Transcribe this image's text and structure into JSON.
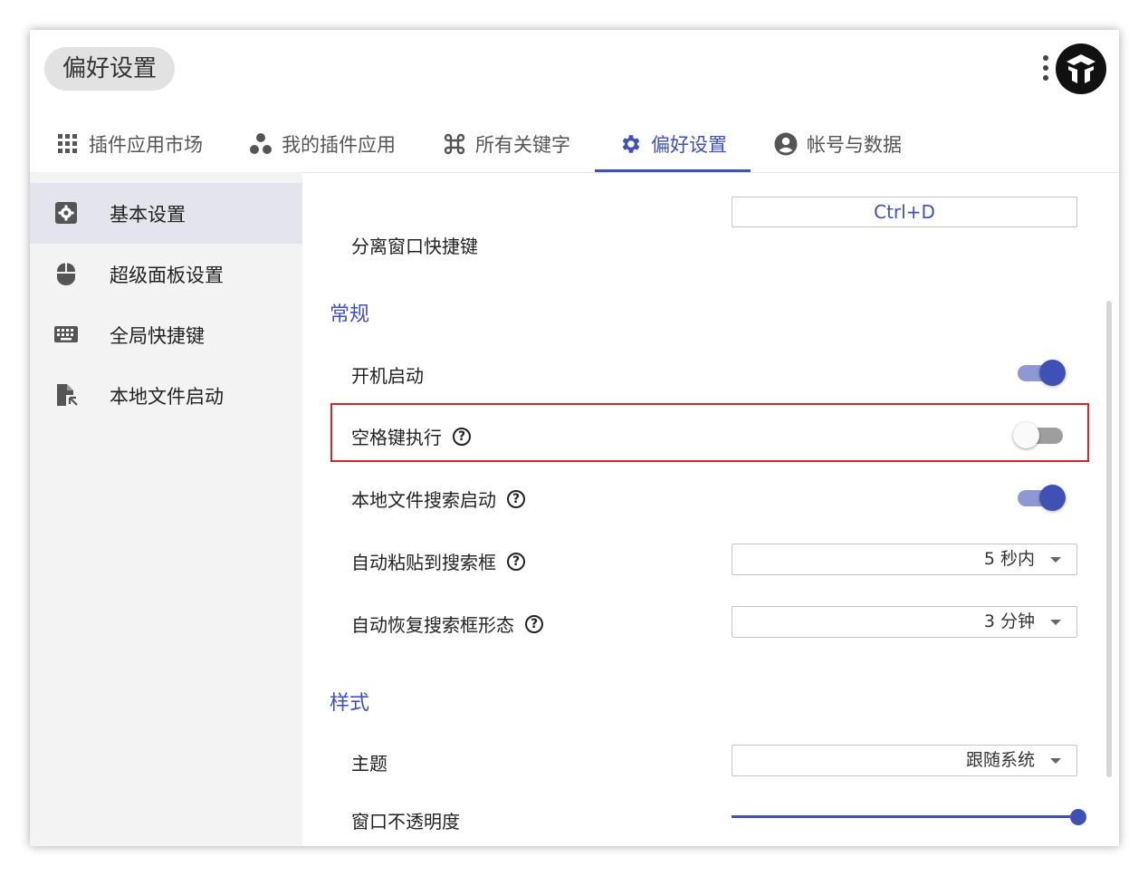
{
  "header": {
    "title": "偏好设置"
  },
  "tabs": [
    {
      "label": "插件应用市场",
      "icon": "apps-grid-icon"
    },
    {
      "label": "我的插件应用",
      "icon": "bubbles-icon"
    },
    {
      "label": "所有关键字",
      "icon": "command-icon"
    },
    {
      "label": "偏好设置",
      "icon": "gear-icon",
      "active": true
    },
    {
      "label": "帐号与数据",
      "icon": "account-circle-icon"
    }
  ],
  "sidebar": {
    "items": [
      {
        "label": "基本设置",
        "icon": "settings-box-icon",
        "active": true
      },
      {
        "label": "超级面板设置",
        "icon": "mouse-icon"
      },
      {
        "label": "全局快捷键",
        "icon": "keyboard-icon"
      },
      {
        "label": "本地文件启动",
        "icon": "file-launch-icon"
      }
    ]
  },
  "settings": {
    "detach_shortcut": {
      "label": "分离窗口快捷键",
      "value": "Ctrl+D"
    },
    "general_title": "常规",
    "autostart": {
      "label": "开机启动",
      "on": true
    },
    "space_execute": {
      "label": "空格键执行",
      "on": false
    },
    "local_file_search": {
      "label": "本地文件搜索启动",
      "on": true
    },
    "auto_paste": {
      "label": "自动粘贴到搜索框",
      "value": "5 秒内"
    },
    "auto_restore": {
      "label": "自动恢复搜索框形态",
      "value": "3 分钟"
    },
    "style_title": "样式",
    "theme": {
      "label": "主题",
      "value": "跟随系统"
    },
    "opacity": {
      "label": "窗口不透明度",
      "value_fraction": 1.0
    }
  },
  "colors": {
    "accent": "#3f51b5",
    "highlight_border": "#d9262e"
  }
}
